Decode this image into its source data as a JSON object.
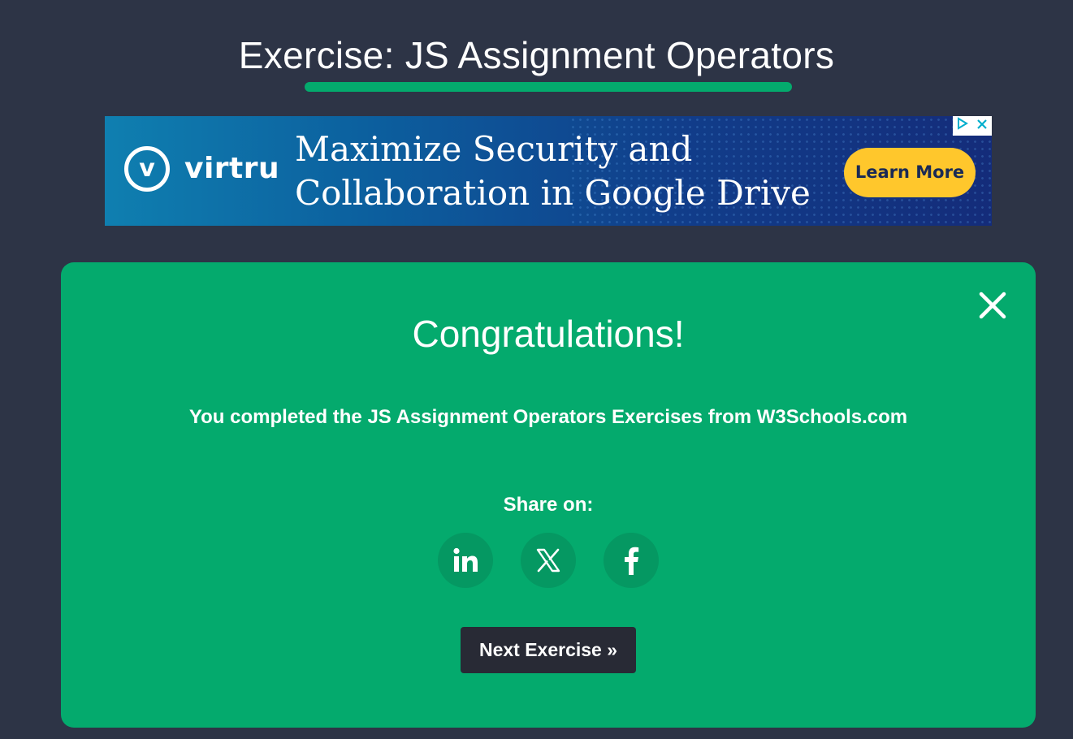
{
  "page": {
    "title": "Exercise: JS Assignment Operators",
    "accent_color": "#04aa6d",
    "background_color": "#2d3446"
  },
  "ad": {
    "brand": "virtru",
    "logo_letter": "v",
    "headline_line1": "Maximize Security and",
    "headline_line2": "Collaboration in Google Drive",
    "cta_label": "Learn More",
    "cta_color": "#ffc72c",
    "adchoices_icon": "adchoices-icon",
    "close_icon": "ad-close-icon"
  },
  "modal": {
    "heading": "Congratulations!",
    "message": "You completed the JS Assignment Operators Exercises from W3Schools.com",
    "share_label": "Share on:",
    "share_buttons": [
      {
        "name": "linkedin",
        "icon": "linkedin-icon"
      },
      {
        "name": "x",
        "icon": "x-icon"
      },
      {
        "name": "facebook",
        "icon": "facebook-icon"
      }
    ],
    "next_button_label": "Next Exercise »",
    "close_icon": "close-icon",
    "background_color": "#04aa6d",
    "button_color": "#282a35"
  }
}
